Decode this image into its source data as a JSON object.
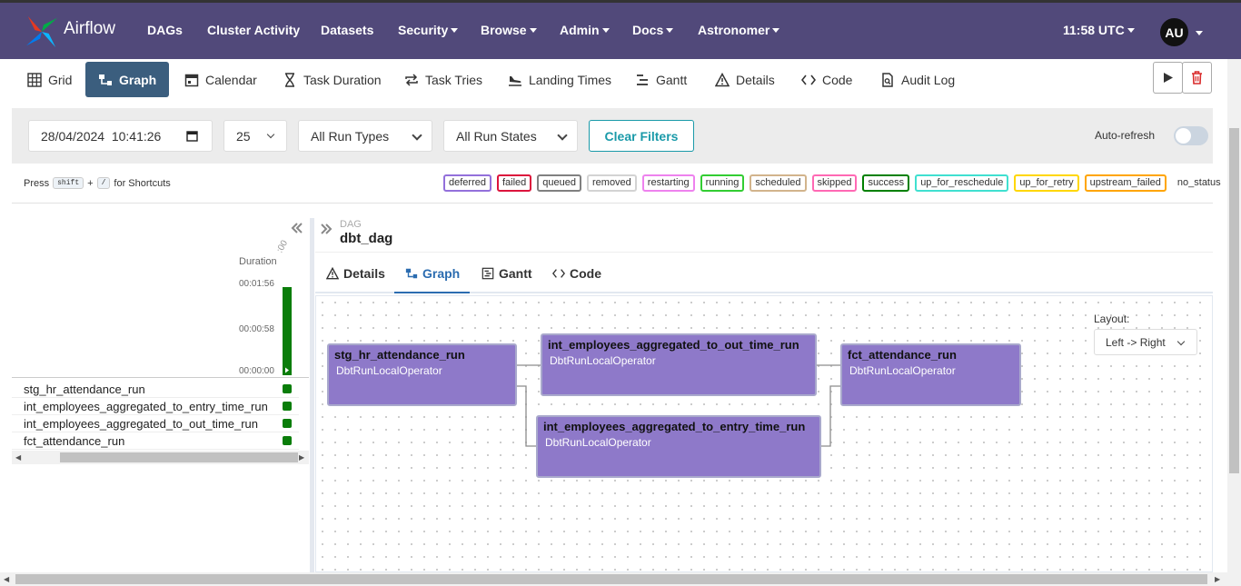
{
  "app": {
    "name": "Airflow"
  },
  "nav": {
    "items": [
      {
        "label": "DAGs",
        "dropdown": false
      },
      {
        "label": "Cluster Activity",
        "dropdown": false
      },
      {
        "label": "Datasets",
        "dropdown": false
      },
      {
        "label": "Security",
        "dropdown": true
      },
      {
        "label": "Browse",
        "dropdown": true
      },
      {
        "label": "Admin",
        "dropdown": true
      },
      {
        "label": "Docs",
        "dropdown": true
      },
      {
        "label": "Astronomer",
        "dropdown": true
      }
    ],
    "time": "11:58 UTC",
    "user_initials": "AU"
  },
  "view_tabs": [
    "Grid",
    "Graph",
    "Calendar",
    "Task Duration",
    "Task Tries",
    "Landing Times",
    "Gantt",
    "Details",
    "Code",
    "Audit Log"
  ],
  "active_view": "Graph",
  "filters": {
    "base_date": "28/04/2024  10:41:26",
    "num_runs": "25",
    "run_type": "All Run Types",
    "run_state": "All Run States",
    "clear_label": "Clear Filters",
    "autorefresh_label": "Auto-refresh",
    "autorefresh_on": false
  },
  "shortcuts": {
    "press": "Press",
    "key1": "shift",
    "plus": "+",
    "key2": "/",
    "suffix": "for Shortcuts"
  },
  "legend": [
    {
      "label": "deferred",
      "color": "#9370db"
    },
    {
      "label": "failed",
      "color": "#dc143c"
    },
    {
      "label": "queued",
      "color": "#808080"
    },
    {
      "label": "removed",
      "color": "#d3d3d3"
    },
    {
      "label": "restarting",
      "color": "#ee82ee"
    },
    {
      "label": "running",
      "color": "#32cd32"
    },
    {
      "label": "scheduled",
      "color": "#d2b48c"
    },
    {
      "label": "skipped",
      "color": "#ff69b4"
    },
    {
      "label": "success",
      "color": "#008000"
    },
    {
      "label": "up_for_reschedule",
      "color": "#40e0d0"
    },
    {
      "label": "up_for_retry",
      "color": "#ffd700"
    },
    {
      "label": "upstream_failed",
      "color": "#ffa500"
    },
    {
      "label": "no_status",
      "color": "none"
    }
  ],
  "grid": {
    "duration_label": "Duration",
    "ticks": [
      "00:01:56",
      "00:00:58",
      "00:00:00"
    ],
    "run_label": ":00",
    "tasks": [
      "stg_hr_attendance_run",
      "int_employees_aggregated_to_entry_time_run",
      "int_employees_aggregated_to_out_time_run",
      "fct_attendance_run"
    ]
  },
  "details": {
    "dag_label": "DAG",
    "dag_id": "dbt_dag",
    "tabs": [
      "Details",
      "Graph",
      "Gantt",
      "Code"
    ],
    "active_tab": "Graph"
  },
  "graph": {
    "layout_label": "Layout:",
    "layout_value": "Left -> Right",
    "node_color": "#8e79c9",
    "nodes": [
      {
        "name": "stg_hr_attendance_run",
        "operator": "DbtRunLocalOperator"
      },
      {
        "name": "int_employees_aggregated_to_out_time_run",
        "operator": "DbtRunLocalOperator"
      },
      {
        "name": "int_employees_aggregated_to_entry_time_run",
        "operator": "DbtRunLocalOperator"
      },
      {
        "name": "fct_attendance_run",
        "operator": "DbtRunLocalOperator"
      }
    ]
  }
}
